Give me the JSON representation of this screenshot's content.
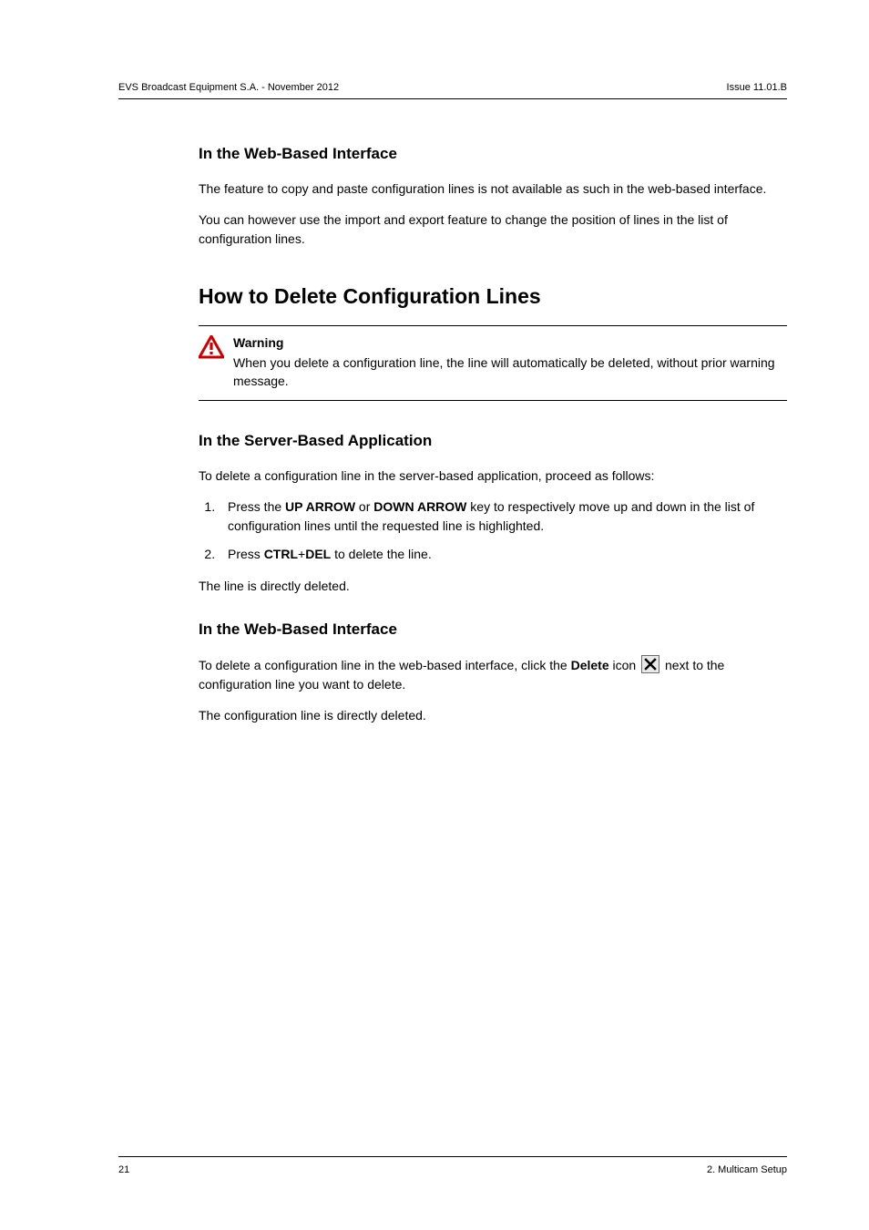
{
  "header": {
    "left": "EVS Broadcast Equipment S.A.  - November 2012",
    "right": "Issue 11.01.B"
  },
  "sections": {
    "web1": {
      "heading": "In the Web-Based Interface",
      "p1": "The feature to copy and paste configuration lines is not available as such in the web-based interface.",
      "p2": "You can however use the import and export feature to change the position of lines in the list of configuration lines."
    },
    "howto": {
      "heading": "How to Delete Configuration Lines"
    },
    "warning": {
      "title": "Warning",
      "body": "When you delete a configuration line, the line will automatically be deleted, without prior warning message."
    },
    "server": {
      "heading": "In the Server-Based Application",
      "intro": "To delete a configuration line in the server-based application, proceed as follows:",
      "step1_pre": "Press the ",
      "step1_k1": "UP ARROW",
      "step1_mid": " or ",
      "step1_k2": "DOWN ARROW",
      "step1_post": " key to respectively move up and down in the list of configuration lines until the requested line is highlighted.",
      "step2_pre": "Press ",
      "step2_k1": "CTRL",
      "step2_plus": "+",
      "step2_k2": "DEL",
      "step2_post": " to delete the line.",
      "after": "The line is directly deleted."
    },
    "web2": {
      "heading": "In the Web-Based Interface",
      "p1_pre": "To delete a configuration line in the web-based interface, click the ",
      "p1_bold": "Delete",
      "p1_mid": " icon ",
      "p1_post": " next to the configuration line you want to delete.",
      "p2": "The configuration line is directly deleted."
    }
  },
  "footer": {
    "left": "21",
    "right": "2. Multicam Setup"
  }
}
